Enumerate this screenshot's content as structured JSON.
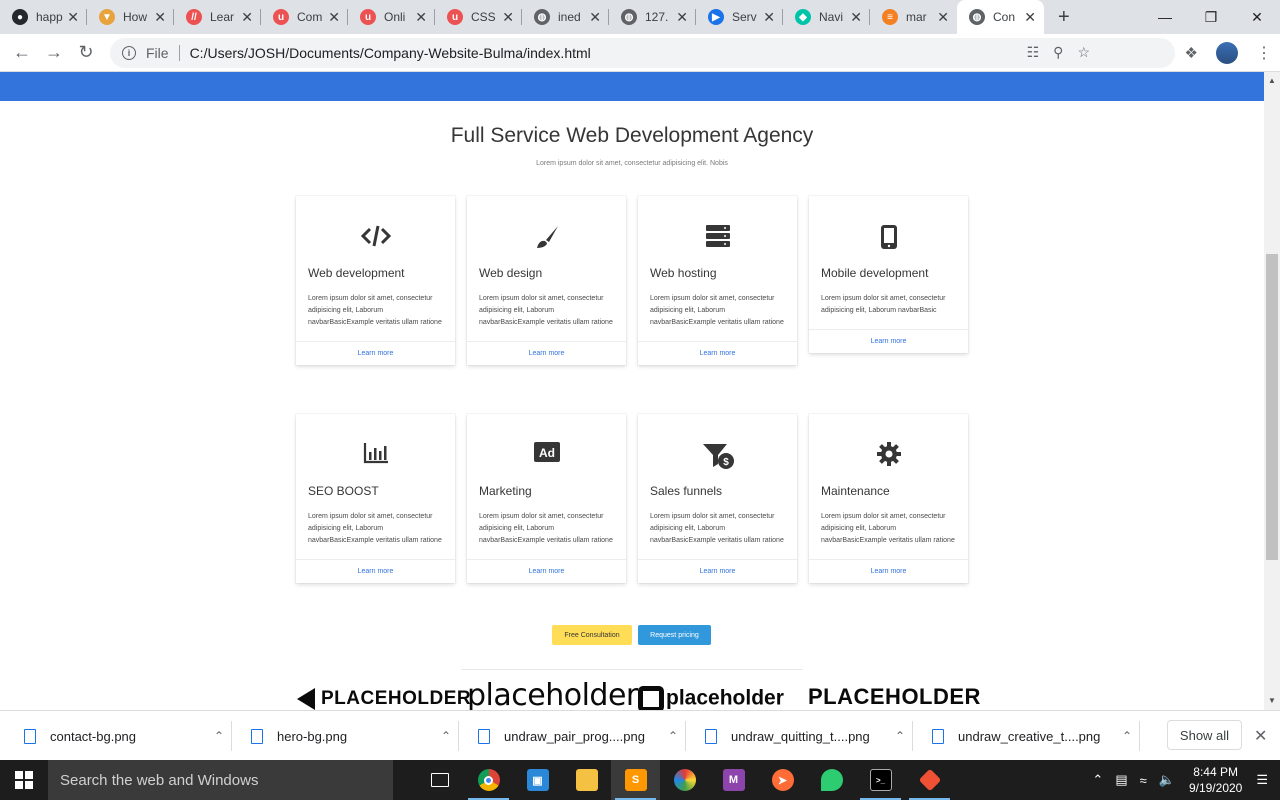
{
  "browser": {
    "tabs": [
      {
        "title": "happ",
        "fav_color": "#24292e",
        "fav_glyph": "●"
      },
      {
        "title": "How",
        "fav_color": "#e8a33d",
        "fav_glyph": "▼"
      },
      {
        "title": "Lear",
        "fav_color": "#ec5252",
        "fav_glyph": "//"
      },
      {
        "title": "Com",
        "fav_color": "#ec5252",
        "fav_glyph": "u"
      },
      {
        "title": "Onli",
        "fav_color": "#ec5252",
        "fav_glyph": "u"
      },
      {
        "title": "CSS",
        "fav_color": "#ec5252",
        "fav_glyph": "u"
      },
      {
        "title": "ined",
        "fav_color": "#5f6368",
        "fav_glyph": "◍"
      },
      {
        "title": "127.",
        "fav_color": "#5f6368",
        "fav_glyph": "◍"
      },
      {
        "title": "Serv",
        "fav_color": "#1a73e8",
        "fav_glyph": "▶"
      },
      {
        "title": "Navi",
        "fav_color": "#00c4a7",
        "fav_glyph": "◆"
      },
      {
        "title": "mar",
        "fav_color": "#f48024",
        "fav_glyph": "≡"
      },
      {
        "title": "Con",
        "fav_color": "#5f6368",
        "fav_glyph": "◍"
      }
    ],
    "active_tab_index": 11,
    "file_label": "File",
    "url": "C:/Users/JOSH/Documents/Company-Website-Bulma/index.html"
  },
  "page": {
    "heading": "Full Service Web Development Agency",
    "subheading": "Lorem ipsum dolor sit amet, consectetur adipisicing elit. Nobis",
    "cards": [
      {
        "icon": "code-icon",
        "title": "Web development",
        "text": "Lorem ipsum dolor sit amet, consectetur adipisicing elit, Laborum navbarBasicExample veritatis ullam ratione",
        "link": "Learn more"
      },
      {
        "icon": "paintbrush-icon",
        "title": "Web design",
        "text": "Lorem ipsum dolor sit amet, consectetur adipisicing elit, Laborum navbarBasicExample veritatis ullam ratione",
        "link": "Learn more"
      },
      {
        "icon": "server-icon",
        "title": "Web hosting",
        "text": "Lorem ipsum dolor sit amet, consectetur adipisicing elit, Laborum navbarBasicExample veritatis ullam ratione",
        "link": "Learn more"
      },
      {
        "icon": "mobile-icon",
        "title": "Mobile development",
        "text": "Lorem ipsum dolor sit amet, consectetur adipisicing elit, Laborum navbarBasic",
        "link": "Learn more"
      },
      {
        "icon": "chart-bar-icon",
        "title": "SEO BOOST",
        "text": "Lorem ipsum dolor sit amet, consectetur adipisicing elit, Laborum navbarBasicExample veritatis ullam ratione",
        "link": "Learn more"
      },
      {
        "icon": "ad-icon",
        "title": "Marketing",
        "text": "Lorem ipsum dolor sit amet, consectetur adipisicing elit, Laborum navbarBasicExample veritatis ullam ratione",
        "link": "Learn more"
      },
      {
        "icon": "funnel-dollar-icon",
        "title": "Sales funnels",
        "text": "Lorem ipsum dolor sit amet, consectetur adipisicing elit, Laborum navbarBasicExample veritatis ullam ratione",
        "link": "Learn more"
      },
      {
        "icon": "cog-icon",
        "title": "Maintenance",
        "text": "Lorem ipsum dolor sit amet, consectetur adipisicing elit, Laborum navbarBasicExample veritatis ullam ratione",
        "link": "Learn more"
      }
    ],
    "buttons": {
      "consultation": "Free Consultation",
      "pricing": "Request pricing"
    },
    "logos": [
      "PLACEHOLDER",
      "placeholder",
      "placeholder",
      "PLACEHOLDER"
    ],
    "colors": {
      "primary": "#3273dc",
      "warning": "#ffdd57",
      "info": "#3298dc"
    }
  },
  "downloads": {
    "items": [
      "contact-bg.png",
      "hero-bg.png",
      "undraw_pair_prog....png",
      "undraw_quitting_t....png",
      "undraw_creative_t....png"
    ],
    "show_all": "Show all"
  },
  "taskbar": {
    "search_placeholder": "Search the web and Windows",
    "time": "8:44 PM",
    "date": "9/19/2020"
  }
}
